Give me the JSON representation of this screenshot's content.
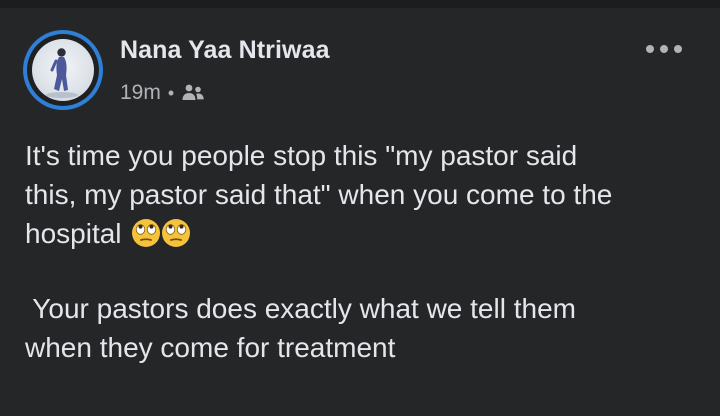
{
  "post": {
    "author": "Nana Yaa Ntriwaa",
    "timestamp": "19m",
    "separator": "•",
    "audience_icon": "friends-icon",
    "more_icon": "more-options-icon",
    "text_lines": [
      "It's time you people stop this \"my pastor said",
      "this, my pastor said that\" when you come to the",
      "hospital"
    ],
    "emoji": [
      "face-with-rolling-eyes",
      "face-with-rolling-eyes"
    ],
    "text_lines_2": [
      " Your pastors does exactly what we tell them",
      "when they come for treatment"
    ]
  },
  "colors": {
    "background": "#252628",
    "text_primary": "#e4e6eb",
    "text_secondary": "#b0b3b8",
    "avatar_ring": "#2f7fd7"
  }
}
